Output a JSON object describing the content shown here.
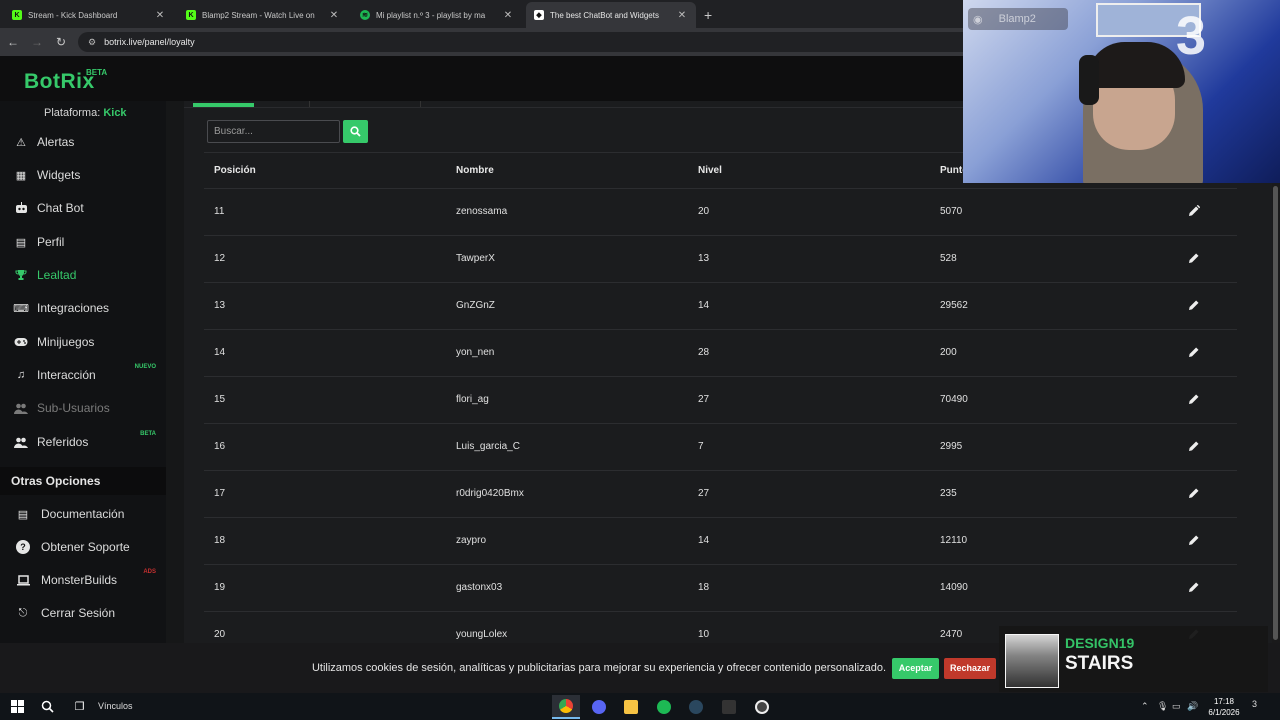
{
  "browser": {
    "tabs": [
      {
        "title": "Stream - Kick Dashboard",
        "favicon": "kick",
        "color": "#53fc18"
      },
      {
        "title": "Blamp2 Stream - Watch Live on",
        "favicon": "kick",
        "color": "#53fc18"
      },
      {
        "title": "Mi playlist n.º 3 - playlist by ma",
        "favicon": "spotify",
        "color": "#1db954"
      },
      {
        "title": "The best ChatBot and Widgets",
        "favicon": "botrix",
        "color": "#ffffff"
      }
    ],
    "url": "botrix.live/panel/loyalty"
  },
  "app": {
    "logo": "BotRix",
    "logo_badge": "BETA",
    "platform_label": "Plataforma:",
    "platform_value": "Kick"
  },
  "sidebar": {
    "items": [
      {
        "label": "Alertas",
        "icon": "warning-icon",
        "glyph": "⚠"
      },
      {
        "label": "Widgets",
        "icon": "grid-icon",
        "glyph": "▦"
      },
      {
        "label": "Chat Bot",
        "icon": "robot-icon",
        "glyph": "🤖"
      },
      {
        "label": "Perfil",
        "icon": "id-card-icon",
        "glyph": "▤"
      },
      {
        "label": "Lealtad",
        "icon": "trophy-icon",
        "glyph": "🏆"
      },
      {
        "label": "Integraciones",
        "icon": "keyboard-icon",
        "glyph": "⌨"
      },
      {
        "label": "Minijuegos",
        "icon": "gamepad-icon",
        "glyph": "🎮"
      },
      {
        "label": "Interacción",
        "icon": "music-icon",
        "glyph": "♫",
        "badge": "NUEVO"
      },
      {
        "label": "Sub-Usuarios",
        "icon": "users-icon",
        "glyph": "👥"
      },
      {
        "label": "Referidos",
        "icon": "user-group-icon",
        "glyph": "👥",
        "badge": "BETA"
      }
    ],
    "section_title": "Otras Opciones",
    "other_items": [
      {
        "label": "Documentación",
        "icon": "book-icon",
        "glyph": "▤"
      },
      {
        "label": "Obtener Soporte",
        "icon": "help-icon",
        "glyph": "?"
      },
      {
        "label": "MonsterBuilds",
        "icon": "laptop-icon",
        "glyph": "💻",
        "badge": "ADS"
      },
      {
        "label": "Cerrar Sesión",
        "icon": "logout-icon",
        "glyph": "⎋"
      }
    ]
  },
  "search": {
    "placeholder": "Buscar..."
  },
  "table": {
    "headers": [
      "Posición",
      "Nombre",
      "Nivel",
      "Puntos"
    ],
    "rows": [
      {
        "pos": "11",
        "name": "zenossama",
        "level": "20",
        "points": "5070"
      },
      {
        "pos": "12",
        "name": "TawperX",
        "level": "13",
        "points": "528"
      },
      {
        "pos": "13",
        "name": "GnZGnZ",
        "level": "14",
        "points": "29562"
      },
      {
        "pos": "14",
        "name": "yon_nen",
        "level": "28",
        "points": "200"
      },
      {
        "pos": "15",
        "name": "flori_ag",
        "level": "27",
        "points": "70490"
      },
      {
        "pos": "16",
        "name": "Luis_garcia_C",
        "level": "7",
        "points": "2995"
      },
      {
        "pos": "17",
        "name": "r0drig0420Bmx",
        "level": "27",
        "points": "235"
      },
      {
        "pos": "18",
        "name": "zaypro",
        "level": "14",
        "points": "12110"
      },
      {
        "pos": "19",
        "name": "gastonx03",
        "level": "18",
        "points": "14090"
      },
      {
        "pos": "20",
        "name": "youngLolex",
        "level": "10",
        "points": "2470"
      }
    ]
  },
  "cookie": {
    "text": "Utilizamos cookies de sesión, analíticas y publicitarias para mejorar su experiencia y ofrecer contenido personalizado.",
    "accept": "Aceptar",
    "reject": "Rechazar"
  },
  "overlay": {
    "discord_user": "Blamp2",
    "webcam_number": "3",
    "music_artist": "DESIGN19",
    "music_song": "STAIRS"
  },
  "taskbar": {
    "links_label": "Vínculos",
    "time": "17:18",
    "date": "6/1/2026",
    "notifications": "3"
  },
  "colors": {
    "accent": "#36c96a",
    "danger": "#c0392b"
  }
}
